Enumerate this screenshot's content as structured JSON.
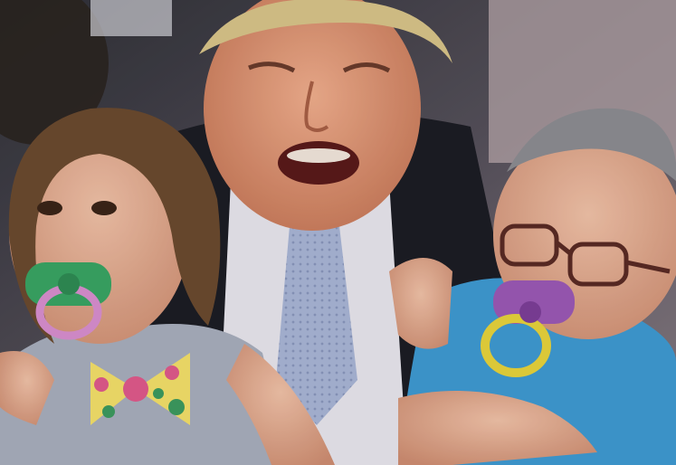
{
  "image": {
    "kind": "photo-collage",
    "subjects": [
      "adult-man-center",
      "baby-left",
      "baby-right"
    ],
    "objects": [
      "green-pacifier",
      "purple-pacifier",
      "polka-dot-bow",
      "eyeglasses",
      "suit-jacket",
      "blue-tie"
    ],
    "colors": {
      "background": "#4a4a52",
      "suit": "#1c1d24",
      "shirt": "#e8e6ee",
      "tie": "#a9b6d6",
      "skin": "#e2a186",
      "left_baby_dress": "#a8aebd",
      "right_baby_shirt": "#3f9ad2",
      "pacifier_green": "#39a564",
      "pacifier_pink_ring": "#d98fcf",
      "pacifier_purple": "#9b59b6",
      "pacifier_yellow_ring": "#e7d33c"
    }
  }
}
